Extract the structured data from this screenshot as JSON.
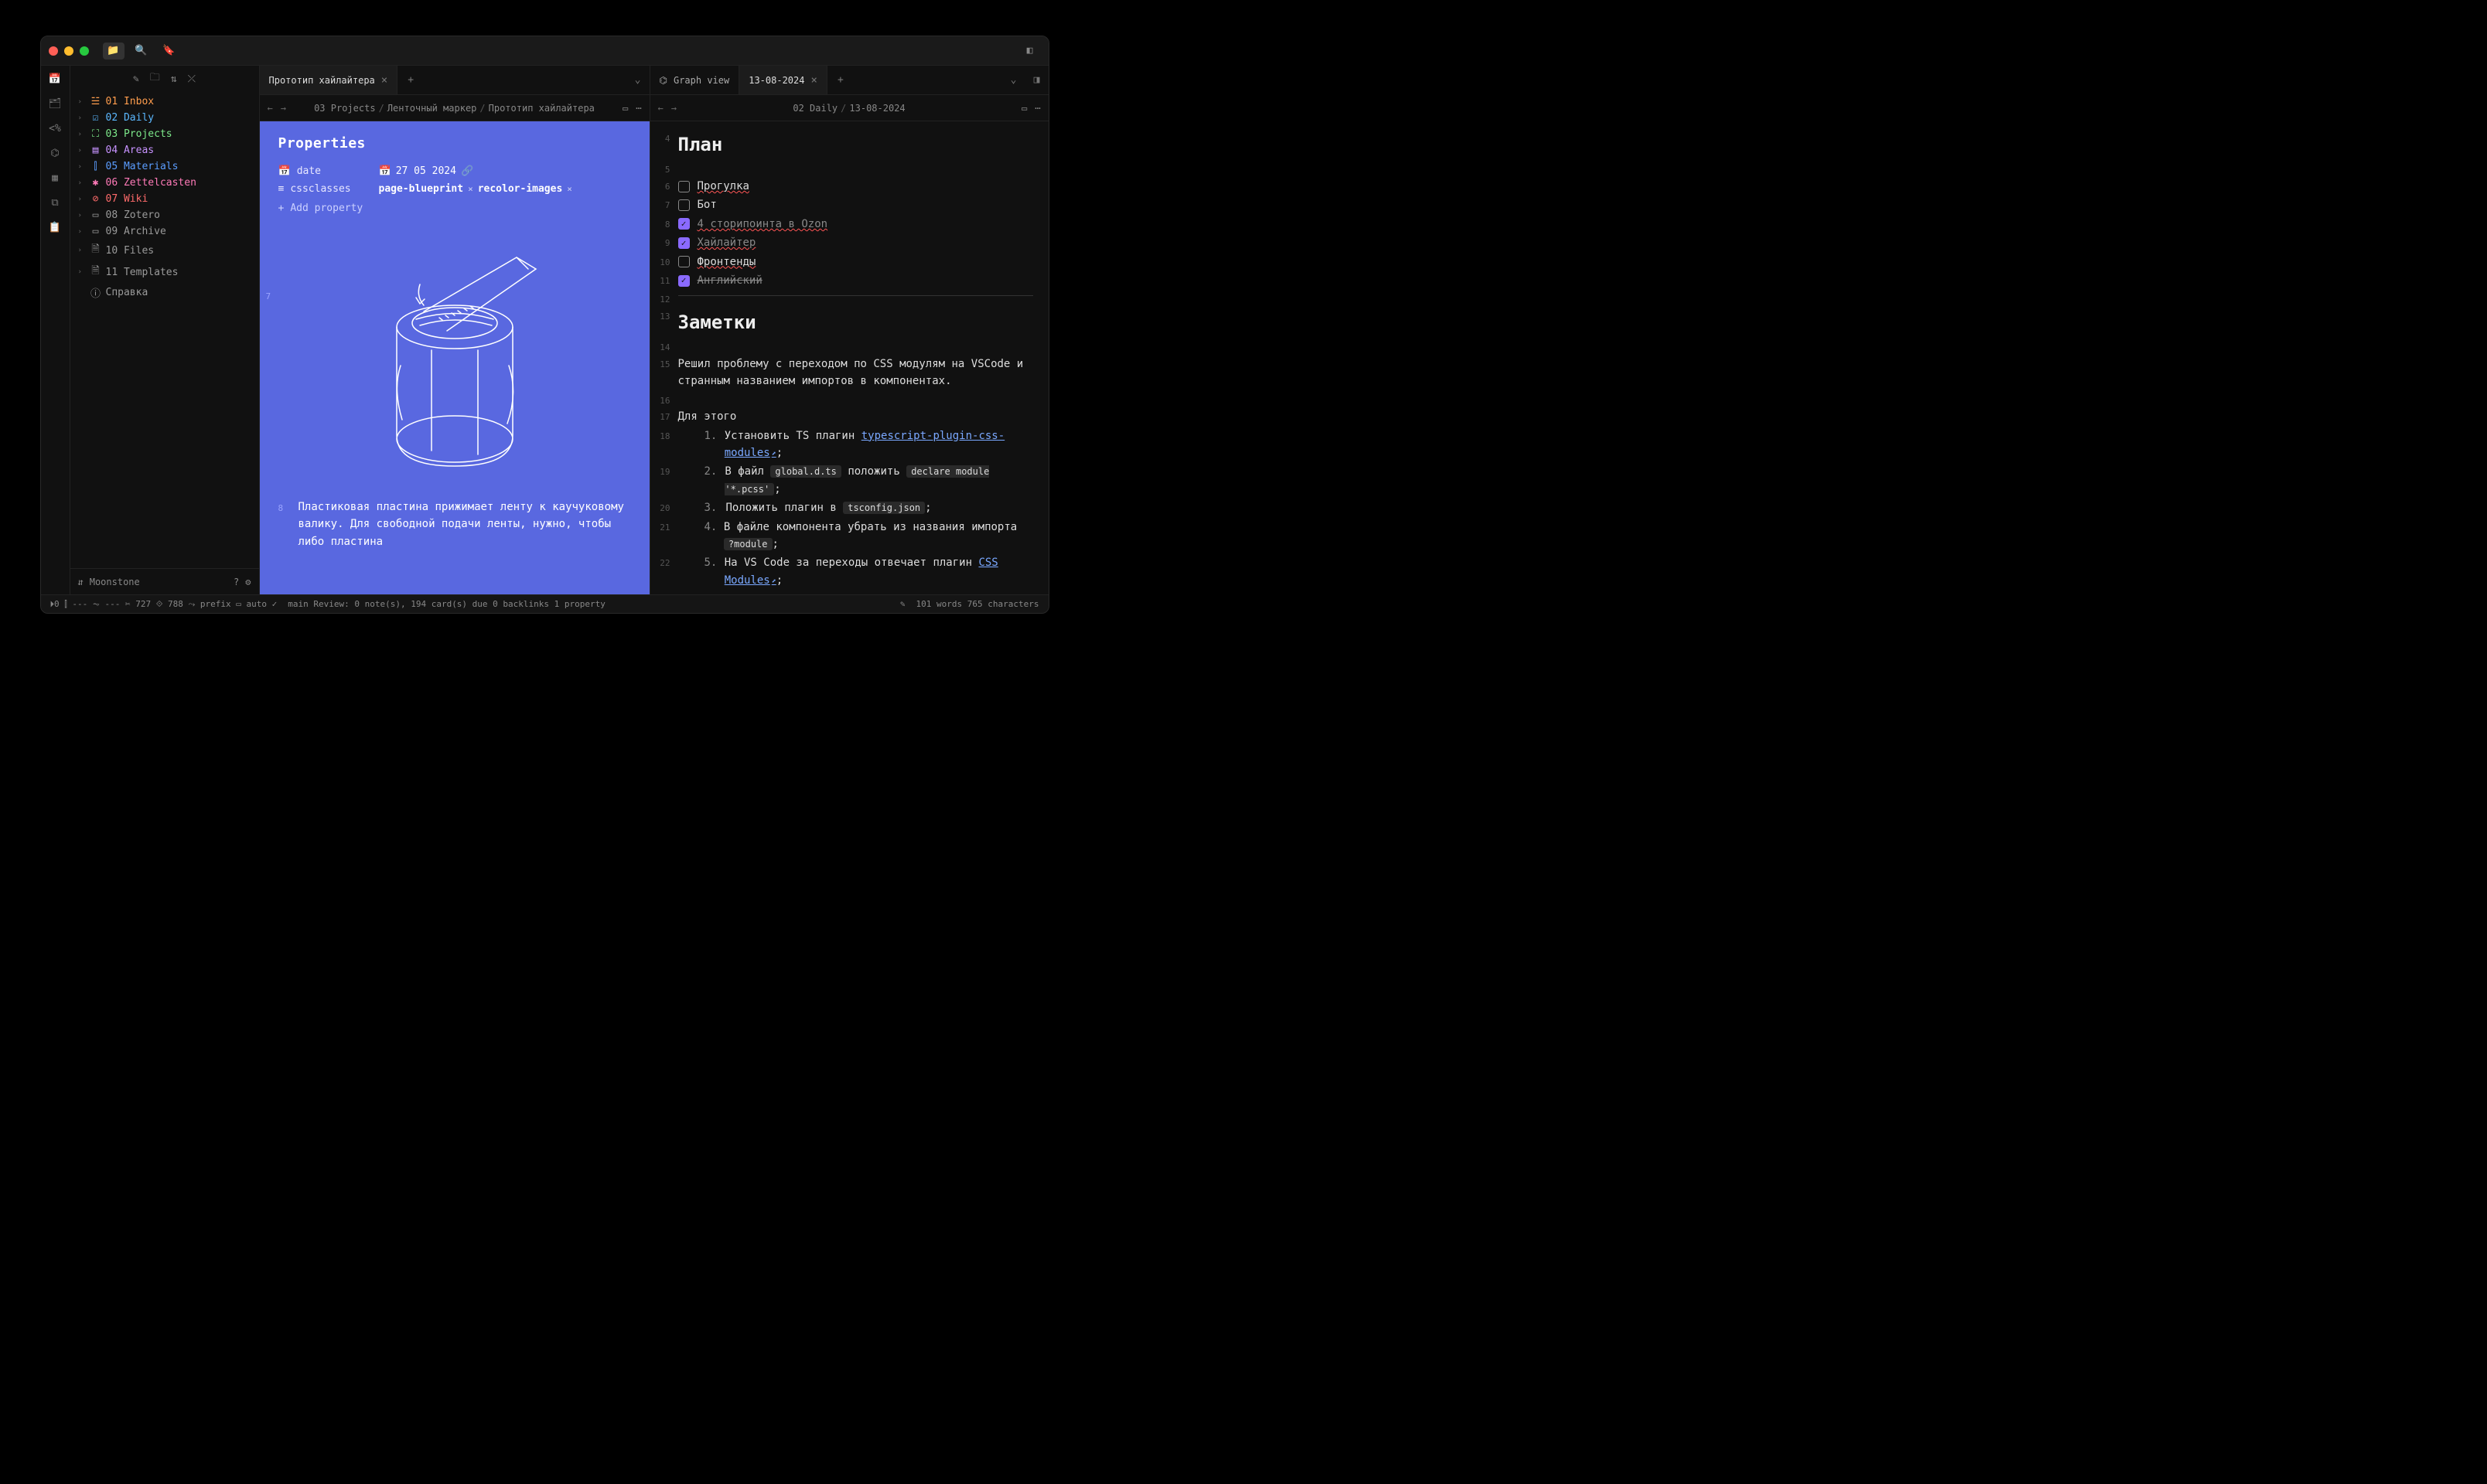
{
  "sidebar": {
    "items": [
      {
        "num": "01",
        "label": "Inbox",
        "color": "c-orange",
        "icon": "☱"
      },
      {
        "num": "02",
        "label": "Daily",
        "color": "c-cyan",
        "icon": "☑"
      },
      {
        "num": "03",
        "label": "Projects",
        "color": "c-green",
        "icon": "⛶"
      },
      {
        "num": "04",
        "label": "Areas",
        "color": "c-purple",
        "icon": "▤"
      },
      {
        "num": "05",
        "label": "Materials",
        "color": "c-blue",
        "icon": "⫿"
      },
      {
        "num": "06",
        "label": "Zettelcasten",
        "color": "c-pink",
        "icon": "✱"
      },
      {
        "num": "07",
        "label": "Wiki",
        "color": "c-red",
        "icon": "⊘"
      },
      {
        "num": "08",
        "label": "Zotero",
        "color": "c-gray",
        "icon": "▭"
      },
      {
        "num": "09",
        "label": "Archive",
        "color": "c-gray",
        "icon": "▭"
      },
      {
        "num": "10",
        "label": "Files",
        "color": "c-gray",
        "icon": "🗎"
      },
      {
        "num": "11",
        "label": "Templates",
        "color": "c-gray",
        "icon": "🗎"
      }
    ],
    "help": "Справка",
    "vault": "Moonstone"
  },
  "left": {
    "tab": "Прототип хайлайтера",
    "crumbs": [
      "03 Projects",
      "Ленточный маркер",
      "Прототип хайлайтера"
    ],
    "props_heading": "Properties",
    "date_key": "date",
    "date_val": "27 05 2024",
    "css_key": "cssclasses",
    "css_chips": [
      "page-blueprint",
      "recolor-images"
    ],
    "add_prop": "Add property",
    "gnum": "7",
    "para_num": "8",
    "para": "Пластиковая пластина прижимает ленту к каучуковому валику. Для свободной подачи ленты, нужно, чтобы либо пластина"
  },
  "right": {
    "tabs": [
      {
        "label": "Graph view",
        "icon": "⌬",
        "active": false
      },
      {
        "label": "13-08-2024",
        "icon": "",
        "active": true
      }
    ],
    "crumbs": [
      "02 Daily",
      "13-08-2024"
    ],
    "plan_heading": "План",
    "tasks": [
      {
        "n": "6",
        "done": false,
        "label": "Прогулка",
        "spell": true
      },
      {
        "n": "7",
        "done": false,
        "label": "Бот",
        "spell": false
      },
      {
        "n": "8",
        "done": true,
        "label": "4 сторипоинта в Ozon",
        "spell": true
      },
      {
        "n": "9",
        "done": true,
        "label": "Хайлайтер",
        "spell": true
      },
      {
        "n": "10",
        "done": false,
        "label": "Фронтенды",
        "spell": true
      },
      {
        "n": "11",
        "done": true,
        "label": "Английский",
        "spell": false
      }
    ],
    "notes_heading": "Заметки",
    "para1": "Решил проблему с переходом по CSS модулям на VSCode и странным названием импортов в компонентах.",
    "para2": "Для этого",
    "steps": [
      {
        "n": "18",
        "i": "1.",
        "pre": "Установить TS плагин ",
        "link": "typescript-plugin-css-modules",
        "post": ";"
      },
      {
        "n": "19",
        "i": "2.",
        "text": "В файл ",
        "c1": "global.d.ts",
        "mid": " положить ",
        "c2": "declare module '*.pcss'",
        "post": ";"
      },
      {
        "n": "20",
        "i": "3.",
        "text": "Положить плагин в ",
        "c1": "tsconfig.json",
        "post": ";"
      },
      {
        "n": "21",
        "i": "4.",
        "text": "В файле компонента убрать из названия импорта ",
        "c1": "?module",
        "post": ";"
      },
      {
        "n": "22",
        "i": "5.",
        "pre": "На VS Code за переходы отвечает плагин ",
        "link": "CSS Modules",
        "post": ";"
      }
    ],
    "ln": {
      "plan": "4",
      "blank1": "5",
      "hr": "12",
      "notes": "13",
      "blank2": "14",
      "p1": "15",
      "blank3": "16",
      "p2": "17"
    }
  },
  "status": {
    "left": [
      "⏵0",
      "⫿ ---",
      "⏦ ---",
      "✂ 727",
      "⟐ 788",
      "⤳ prefix",
      "▭ auto",
      "✓"
    ],
    "mid": "main Review: 0 note(s), 194 card(s) due  0 backlinks  1 property",
    "right": "101 words 765 characters"
  }
}
